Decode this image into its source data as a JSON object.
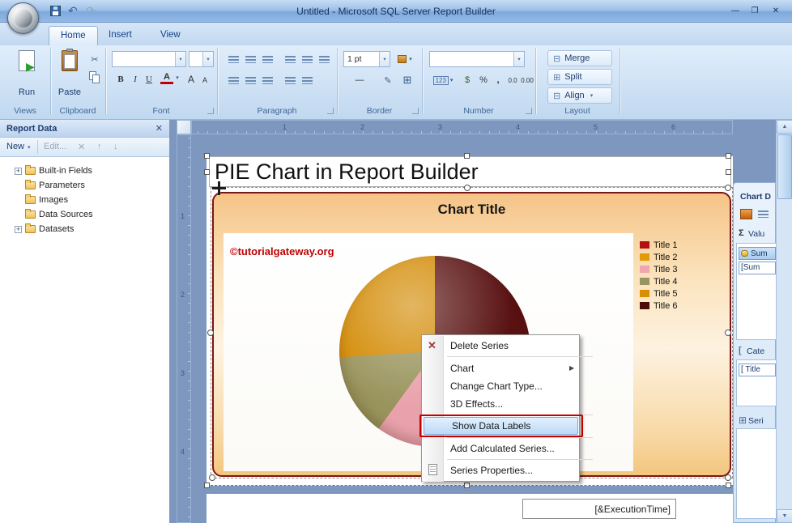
{
  "window": {
    "title": "Untitled - Microsoft SQL Server Report Builder"
  },
  "icons": {
    "minimize": "—",
    "maximize": "❐",
    "close": "✕",
    "dropdown": "▾",
    "submenu": "▶",
    "undo": "↶",
    "redo": "↷",
    "cut": "✂",
    "pencil": "✎",
    "grid": "⊞",
    "merge": "⊟",
    "dash": "—",
    "up": "↑",
    "down": "↓",
    "delete": "✕",
    "plus": "+",
    "play": "▶",
    "scroll_up": "▲",
    "scroll_down": "▼",
    "bracket": "["
  },
  "ribbon": {
    "tabs": [
      "Home",
      "Insert",
      "View"
    ],
    "views": {
      "label": "Views",
      "run": "Run"
    },
    "clipboard": {
      "label": "Clipboard",
      "paste": "Paste"
    },
    "font": {
      "label": "Font",
      "bold": "B",
      "italic": "I",
      "underline": "U",
      "color": "A",
      "grow": "A",
      "shrink": "A"
    },
    "paragraph": {
      "label": "Paragraph"
    },
    "border": {
      "label": "Border",
      "width": "1 pt"
    },
    "number": {
      "label": "Number",
      "b123": "123",
      "dollar": "$",
      "percent": "%",
      "comma": ",",
      "inc": "0.0",
      "dec": "0.00"
    },
    "layout": {
      "label": "Layout",
      "merge": "Merge",
      "split": "Split",
      "align": "Align"
    }
  },
  "report_data_pane": {
    "title": "Report Data",
    "new": "New",
    "edit": "Edit...",
    "tree": [
      {
        "label": "Built-in Fields"
      },
      {
        "label": "Parameters"
      },
      {
        "label": "Images"
      },
      {
        "label": "Data Sources"
      },
      {
        "label": "Datasets"
      }
    ]
  },
  "rulers": {
    "horizontal": [
      "1",
      "2",
      "3",
      "4",
      "5",
      "6"
    ],
    "vertical": [
      "1",
      "2",
      "3",
      "4"
    ]
  },
  "report": {
    "title": "PIE Chart in Report Builder",
    "execution_time": "[&ExecutionTime]"
  },
  "chart": {
    "title": "Chart Title",
    "watermark": "©tutorialgateway.org",
    "legend": [
      {
        "label": "Title 1",
        "color": "#b50f0f"
      },
      {
        "label": "Title 2",
        "color": "#e29a06"
      },
      {
        "label": "Title 3",
        "color": "#efa6ae"
      },
      {
        "label": "Title 4",
        "color": "#9a9460"
      },
      {
        "label": "Title 5",
        "color": "#d88d05"
      },
      {
        "label": "Title 6",
        "color": "#4d0c0c"
      }
    ]
  },
  "chart_data": {
    "type": "pie",
    "title": "Chart Title",
    "legend_position": "right",
    "slices": [
      {
        "name": "Title 6",
        "color": "#591111",
        "value": 36
      },
      {
        "name": "Title 1",
        "color": "#b50f0f",
        "value": 4
      },
      {
        "name": "Title 2",
        "color": "#e29a06",
        "value": 4
      },
      {
        "name": "Title 3",
        "color": "#e9a2ac",
        "value": 16
      },
      {
        "name": "Title 4",
        "color": "#99945c",
        "value": 14
      },
      {
        "name": "Title 5",
        "color": "#d28900",
        "value": 26
      }
    ]
  },
  "context_menu": {
    "items": [
      {
        "label": "Delete Series"
      },
      {
        "label": "Chart"
      },
      {
        "label": "Change Chart Type..."
      },
      {
        "label": "3D Effects..."
      },
      {
        "label": "Show Data Labels"
      },
      {
        "label": "Add Calculated Series..."
      },
      {
        "label": "Series Properties..."
      }
    ]
  },
  "chart_data_pane": {
    "title": "Chart D",
    "sigma": "Σ",
    "values_header": "Valu",
    "value_item": "Sum",
    "value_field": "[Sum",
    "categories_header": "Cate",
    "category_item": "[ Title",
    "series_header": "Seri"
  }
}
